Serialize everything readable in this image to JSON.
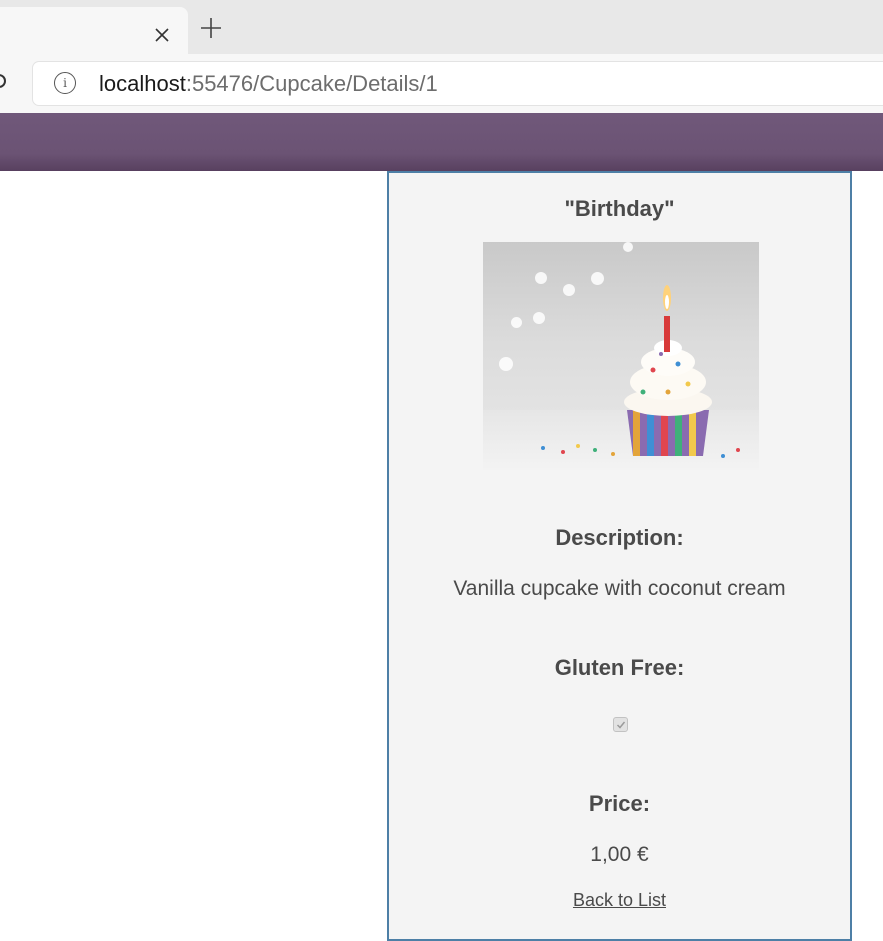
{
  "browser": {
    "tab_close_glyph": "✕",
    "new_tab_glyph": "+",
    "url_host": "localhost",
    "url_path": ":55476/Cupcake/Details/1",
    "info_glyph": "i"
  },
  "theme": {
    "header_color": "#6b5374",
    "card_border_color": "#4d7fa6",
    "card_background": "#f4f4f4"
  },
  "details": {
    "title": "\"Birthday\"",
    "description_label": "Description:",
    "description_value": "Vanilla cupcake with coconut cream",
    "gluten_free_label": "Gluten Free:",
    "gluten_free_checked": true,
    "price_label": "Price:",
    "price_value": "1,00 €",
    "back_link": "Back to List"
  },
  "icons": {
    "tab_close": "close-icon",
    "new_tab": "plus-icon",
    "info": "info-icon",
    "refresh": "refresh-icon"
  }
}
